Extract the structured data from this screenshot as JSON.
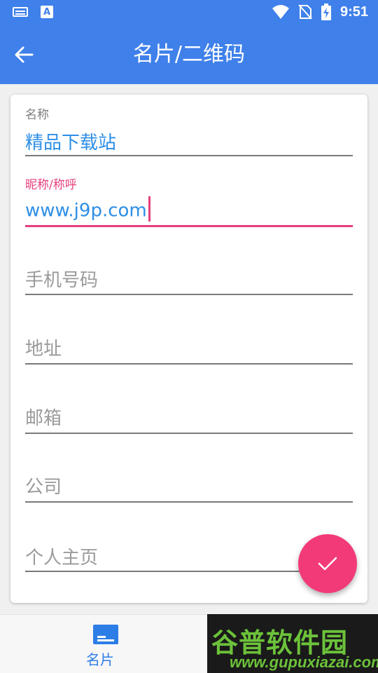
{
  "status_bar": {
    "time": "9:51",
    "icons": [
      "keyboard-icon",
      "a-app-icon",
      "wifi-icon",
      "no-sim-icon",
      "battery-charging-icon"
    ]
  },
  "app_bar": {
    "title": "名片/二维码",
    "back_icon": "arrow-back-icon"
  },
  "form": {
    "name": {
      "label": "名称",
      "value": "精品下载站"
    },
    "nickname": {
      "label": "昵称/称呼",
      "value": "www.j9p.com"
    },
    "phone": {
      "placeholder": "手机号码"
    },
    "address": {
      "placeholder": "地址"
    },
    "email": {
      "placeholder": "邮箱"
    },
    "company": {
      "placeholder": "公司"
    },
    "homepage": {
      "placeholder": "个人主页"
    }
  },
  "fab": {
    "icon": "check-icon"
  },
  "bottom_nav": {
    "items": [
      {
        "label": "名片",
        "icon": "card-icon",
        "active": true
      }
    ]
  },
  "watermark": {
    "title": "谷普软件园",
    "url": "www.gupuxiazai.com"
  },
  "colors": {
    "primary": "#3f80ea",
    "accent": "#e53e7d",
    "value_text": "#2d8ee6",
    "fab": "#f23a78"
  }
}
